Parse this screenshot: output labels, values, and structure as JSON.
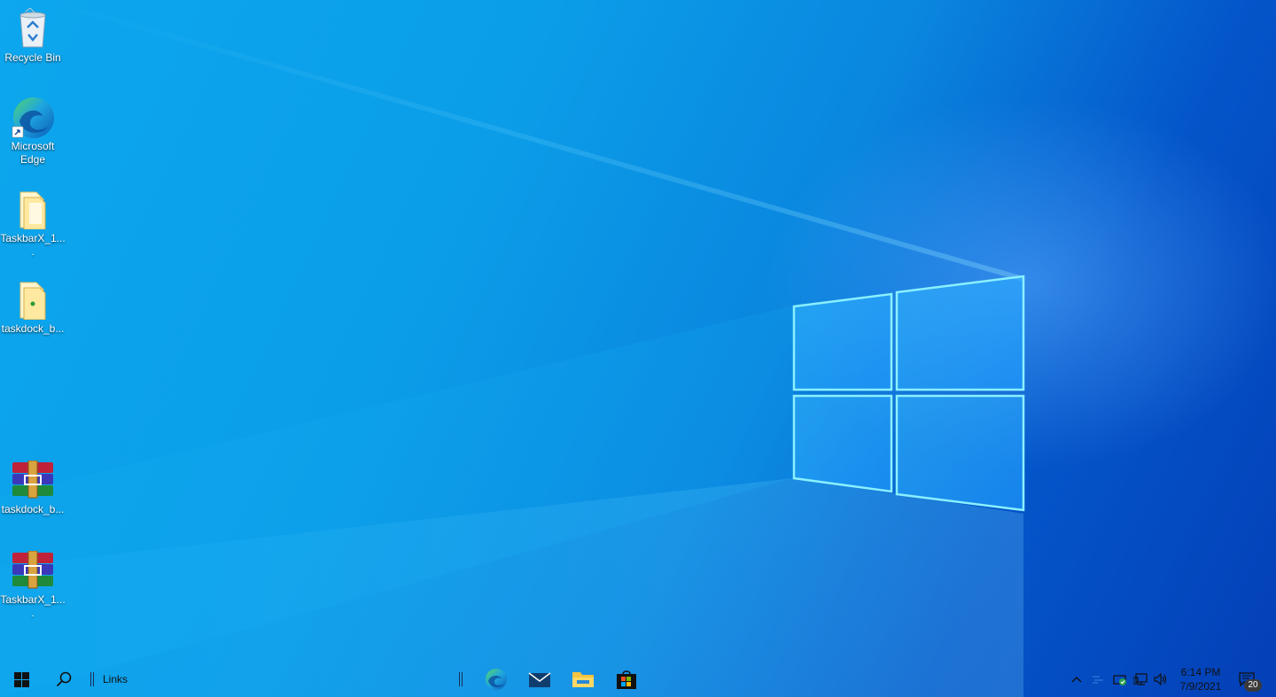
{
  "desktop": {
    "icons": [
      {
        "label": "Recycle Bin",
        "icon": "recycle-bin-icon"
      },
      {
        "label": "Microsoft Edge",
        "icon": "edge-icon"
      },
      {
        "label": "TaskbarX_1....",
        "icon": "folder-icon"
      },
      {
        "label": "taskdock_b...",
        "icon": "folder-icon"
      },
      {
        "label": "taskdock_b...",
        "icon": "winrar-archive-icon"
      },
      {
        "label": "TaskbarX_1....",
        "icon": "winrar-archive-icon"
      }
    ]
  },
  "taskbar": {
    "links_label": "Links",
    "pinned": [
      "edge-icon",
      "mail-icon",
      "file-explorer-icon",
      "store-icon"
    ],
    "tray": [
      "chevron-up-icon",
      "app-tray-icon",
      "security-icon",
      "network-icon",
      "volume-icon"
    ],
    "clock": {
      "time": "6:14 PM",
      "date": "7/9/2021"
    },
    "notifications_count": "20"
  },
  "colors": {
    "wallpaper_light": "#0ca7ee",
    "wallpaper_dark": "#043fb7",
    "logo_pane": "#4fc3ff"
  }
}
